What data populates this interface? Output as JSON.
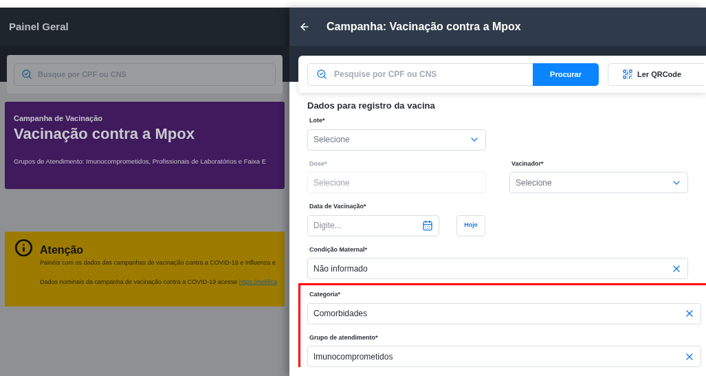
{
  "background": {
    "header": {
      "title": "Painel Geral"
    },
    "search": {
      "placeholder": "Busque por CPF ou CNS"
    },
    "campaign_card": {
      "kicker": "Campanha de Vacinação",
      "title": "Vacinação contra a Mpox",
      "groups": "Grupos de Atendimento: Imunocomprometidos, Profissionais de Laboratórios e Faixa E"
    },
    "notice": {
      "title": "Atenção",
      "lines": [
        "Painéis com os dados das campanhas de vacinação contra a COVID-19 e Influenza e",
        "Dados nominais da campanha de vacinação contra a COVID-19 acesse "
      ],
      "link": "https://notifica"
    }
  },
  "drawer": {
    "title": "Campanha: Vacinação contra a Mpox",
    "search": {
      "placeholder": "Pesquise por CPF ou CNS",
      "button": "Procurar",
      "qr_button": "Ler QRCode"
    },
    "section_title": "Dados para registro da vacina",
    "rows": [
      {
        "highlighted": false,
        "fields": [
          {
            "kind": "select",
            "label": "Lote",
            "required_mark": "*",
            "placeholder": "Selecione",
            "disabled": false
          }
        ]
      },
      {
        "highlighted": false,
        "fields": [
          {
            "kind": "select",
            "label": "Dose",
            "required_mark": "*",
            "placeholder": "Selecione",
            "disabled": true
          },
          {
            "kind": "select",
            "label": "Vacinador",
            "required_mark": "*",
            "placeholder": "Selecione",
            "disabled": false
          }
        ]
      },
      {
        "highlighted": false,
        "fields": [
          {
            "kind": "date",
            "label": "Data de Vacinação",
            "required_mark": "*",
            "placeholder": "Digite...",
            "button": "Hoje",
            "disabled": false
          }
        ]
      },
      {
        "highlighted": false,
        "fields": [
          {
            "kind": "clearable",
            "label": "Condição Maternal",
            "required_mark": "*",
            "value": "Não informado",
            "disabled": false
          }
        ]
      },
      {
        "highlighted": true,
        "fields": [
          {
            "kind": "clearable",
            "label": "Categoria",
            "required_mark": "*",
            "value": "Comorbidades",
            "disabled": false
          }
        ]
      },
      {
        "highlighted": true,
        "fields": [
          {
            "kind": "clearable",
            "label": "Grupo de atendimento",
            "required_mark": "*",
            "value": "Imunocomprometidos",
            "disabled": false
          }
        ]
      }
    ]
  }
}
